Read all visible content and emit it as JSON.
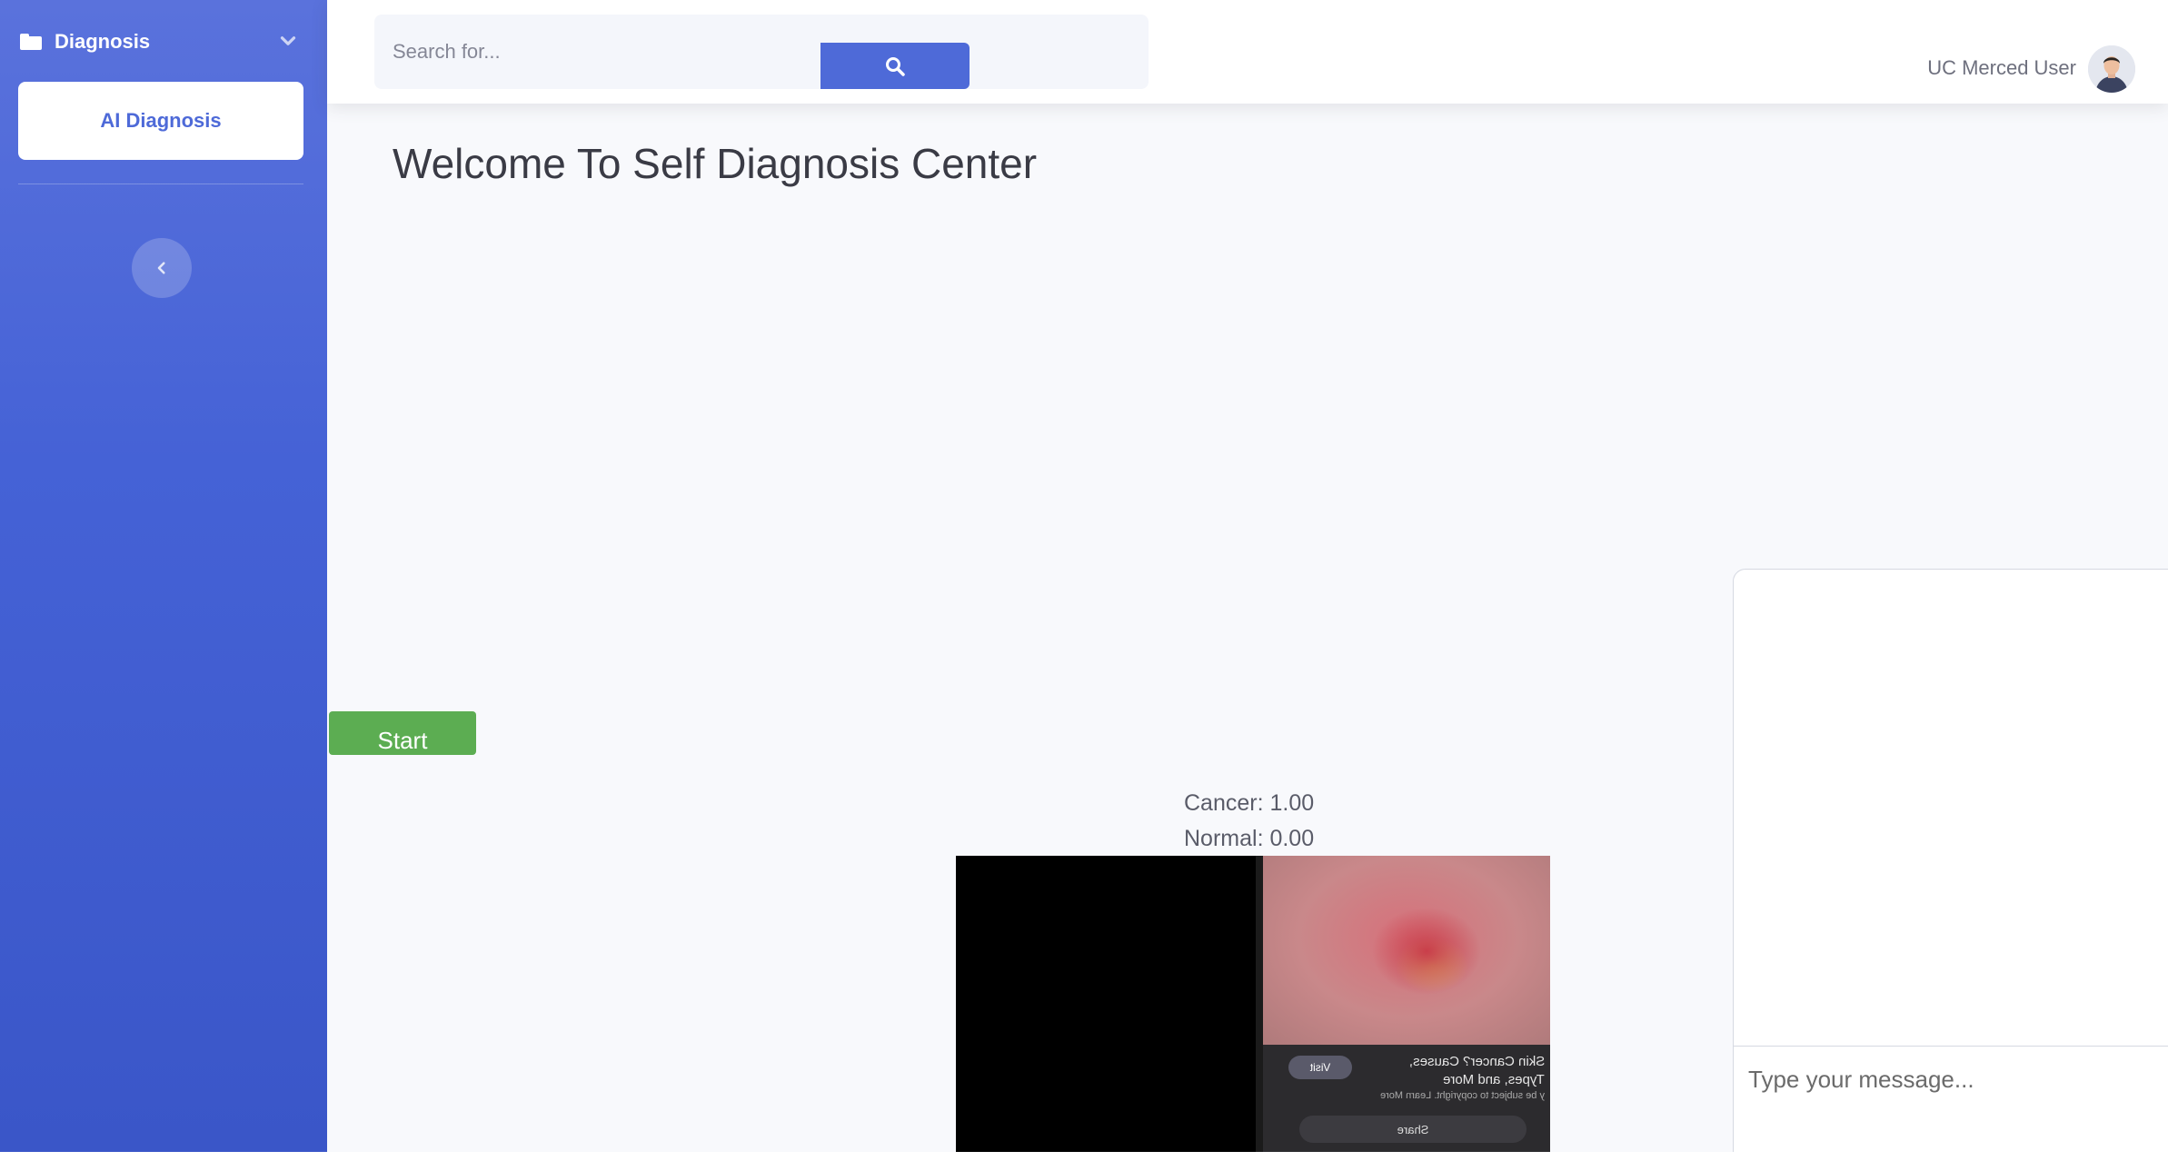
{
  "sidebar": {
    "section_label": "Diagnosis",
    "items": [
      {
        "label": "AI Diagnosis"
      }
    ]
  },
  "topbar": {
    "search_placeholder": "Search for...",
    "user_name": "UC Merced User"
  },
  "main": {
    "title": "Welcome To Self Diagnosis Center",
    "start_label": "Start",
    "predictions": [
      {
        "text": "Cancer: 1.00"
      },
      {
        "text": "Normal: 0.00"
      }
    ],
    "video_overlay": {
      "caption_line1": "Skin Cancer? Causes,",
      "caption_line2": "Types, and More",
      "caption_line3": "y be subject to copyright. Learn More",
      "visit_label": "Visit",
      "share_label": "Share"
    }
  },
  "chat": {
    "input_placeholder": "Type your message..."
  },
  "colors": {
    "sidebar_accent": "#4e6ad8",
    "start_button": "#5cad52"
  },
  "icons": [
    "folder-icon",
    "chevron-down-icon",
    "chevron-left-icon",
    "search-icon",
    "user-avatar-icon"
  ]
}
